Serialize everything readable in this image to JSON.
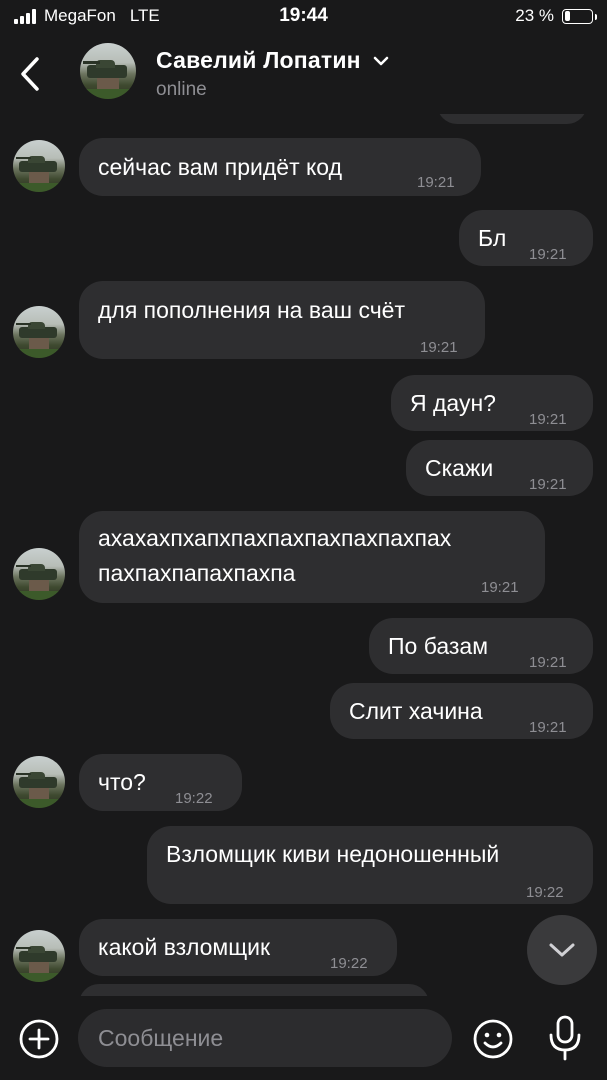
{
  "status_bar": {
    "carrier": "MegaFon",
    "network": "LTE",
    "time": "19:44",
    "battery": "23 %",
    "battery_level": 0.23
  },
  "header": {
    "name": "Савелий Лопатин",
    "status": "online"
  },
  "messages": [
    {
      "side": "in",
      "text": "сейчас вам придёт код",
      "time": "19:21"
    },
    {
      "side": "out",
      "text": "Бл",
      "time": "19:21"
    },
    {
      "side": "in",
      "text": "для пополнения на ваш счёт",
      "time": "19:21"
    },
    {
      "side": "out",
      "text": "Я даун?",
      "time": "19:21"
    },
    {
      "side": "out",
      "text": "Скажи",
      "time": "19:21"
    },
    {
      "side": "in",
      "text_line1": "ахахахпхапхпахпахпахпахпахпах",
      "text_line2": "пахпахпапахпахпа",
      "time": "19:21"
    },
    {
      "side": "out",
      "text": "По базам",
      "time": "19:21"
    },
    {
      "side": "out",
      "text": "Слит хачина",
      "time": "19:21"
    },
    {
      "side": "in",
      "text": "что?",
      "time": "19:22"
    },
    {
      "side": "out",
      "text": "Взломщик киви недоношенный",
      "time": "19:22"
    },
    {
      "side": "in",
      "text": "какой взломщик",
      "time": "19:22"
    }
  ],
  "composer": {
    "placeholder": "Сообщение"
  },
  "icons": {
    "back": "chevron-left-icon",
    "dropdown": "chevron-down-icon",
    "scroll_down": "chevron-down-icon",
    "add": "plus-circle-icon",
    "emoji": "smiley-icon",
    "mic": "microphone-icon"
  },
  "colors": {
    "background": "#19191a",
    "bubble": "#2e2e30",
    "time_text": "#8e8e93",
    "text": "#ffffff"
  }
}
